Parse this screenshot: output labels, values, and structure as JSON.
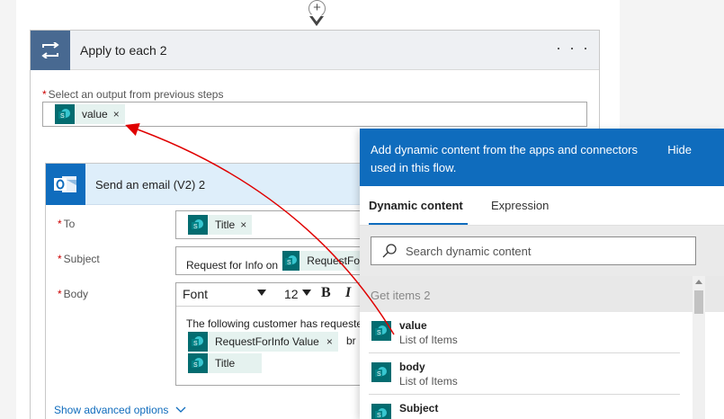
{
  "apply": {
    "title": "Apply to each 2",
    "more": "· · ·",
    "field_label": "Select an output from previous steps",
    "required_mark": "*",
    "token": "value",
    "token_remove": "×"
  },
  "email": {
    "title": "Send an email (V2) 2",
    "to_label": "To",
    "subject_label": "Subject",
    "body_label": "Body",
    "to_token": "Title",
    "subject_prefix": "Request for Info on",
    "subject_token": "RequestFo",
    "font_select": "Font",
    "font_size": "12",
    "bold": "B",
    "italic": "I",
    "body_text": "The following customer has requeste",
    "body_text_tail": "br",
    "body_token1": "RequestForInfo Value",
    "body_token2": "Title",
    "token_remove": "×",
    "show_advanced": "Show advanced options"
  },
  "dynamic": {
    "header_text": "Add dynamic content from the apps and connectors used in this flow.",
    "hide": "Hide",
    "tabs": [
      "Dynamic content",
      "Expression"
    ],
    "search_placeholder": "Search dynamic content",
    "group": "Get items 2",
    "items": [
      {
        "name": "value",
        "desc": "List of Items"
      },
      {
        "name": "body",
        "desc": "List of Items"
      },
      {
        "name": "Subject",
        "desc": ""
      }
    ]
  },
  "icons": {
    "connector_plus": "plus-icon",
    "loop": "loop-icon",
    "outlook": "outlook-icon",
    "sharepoint": "sharepoint-icon",
    "search": "search-icon",
    "chevron": "chevron-down-icon"
  },
  "colors": {
    "loop_header_icon": "#486991",
    "outlook_blue": "#0f6cbd",
    "sharepoint_teal": "#036c70",
    "token_bg": "#e5f2ef",
    "annotation_arrow": "#e00000",
    "required": "#c00000"
  }
}
